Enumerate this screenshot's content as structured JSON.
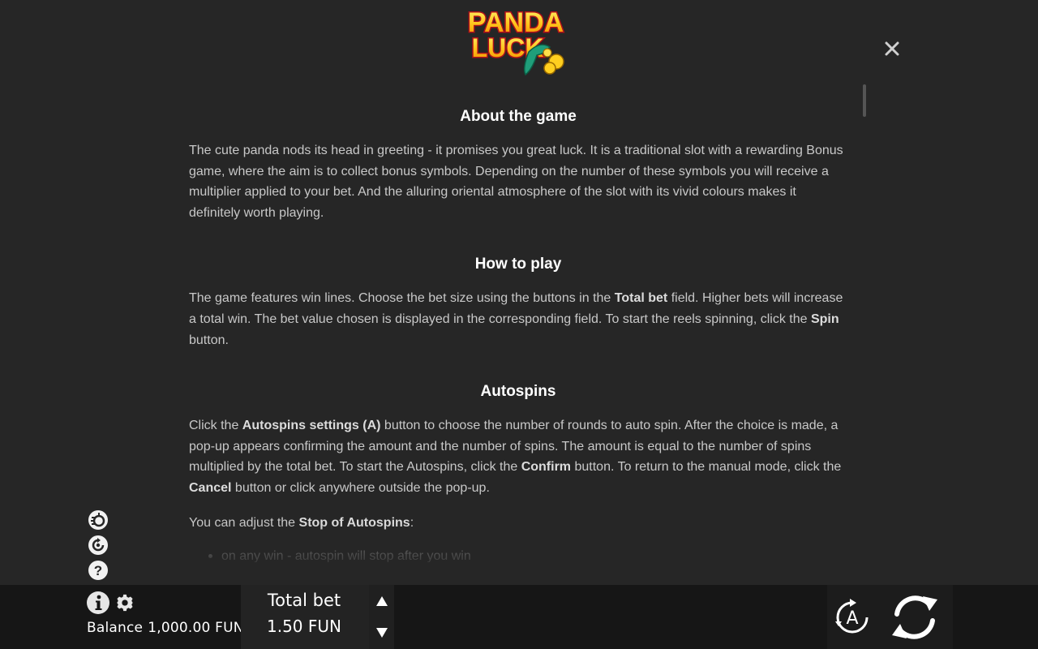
{
  "logo": {
    "line1": "PANDA",
    "line2": "LUCK"
  },
  "icons": {
    "close": "close-icon",
    "turbo": "turbo-spin-icon",
    "autoplay": "autoplay-icon",
    "help": "question-icon",
    "info": "info-icon",
    "settings": "gear-icon",
    "autospin": "autospin-icon",
    "spin": "spin-icon"
  },
  "rules": {
    "about_title": "About the game",
    "about_text": "The cute panda nods its head in greeting - it promises you great luck. It is a traditional slot with a rewarding Bonus game, where the aim is to collect bonus symbols. Depending on the number of these symbols you will receive a multiplier applied to your bet. And the alluring oriental atmosphere of the slot with its vivid colours makes it definitely worth playing.",
    "howto_title": "How to play",
    "howto_p1": "The game features win lines. Choose the bet size using the buttons in the ",
    "howto_b1": "Total bet",
    "howto_p2": " field. Higher bets will increase a total win. The bet value chosen is displayed in the corresponding field. To start the reels spinning, click the ",
    "howto_b2": "Spin",
    "howto_p3": " button.",
    "auto_title": "Autospins",
    "auto_p1": "Click the ",
    "auto_b1": "Autospins settings (A)",
    "auto_p2": " button to choose the number of rounds to auto spin. After the choice is made, a pop-up appears confirming the amount and the number of spins. The amount is equal to the number of spins multiplied by the total bet. To start the Autospins, click the ",
    "auto_b2": "Confirm",
    "auto_p3": " button. To return to the manual mode, click the ",
    "auto_b3": "Cancel",
    "auto_p4": " button or click anywhere outside the pop-up.",
    "stop_p1": "You can adjust the ",
    "stop_b1": "Stop of Autospins",
    "stop_p2": ":",
    "bullets": [
      "on any win - autospin will stop after you win"
    ]
  },
  "footer": {
    "balance_label": "Balance",
    "balance_value": "1,000.00 FUN",
    "total_bet_label": "Total bet",
    "total_bet_value": "1.50 FUN",
    "autospin_letter": "A"
  },
  "colors": {
    "background": "#262626",
    "bottom_bar": "#161616",
    "logo_yellow": "#ffd21e",
    "logo_red": "#c4161c",
    "text": "#c8c8c8",
    "heading": "#ffffff"
  }
}
